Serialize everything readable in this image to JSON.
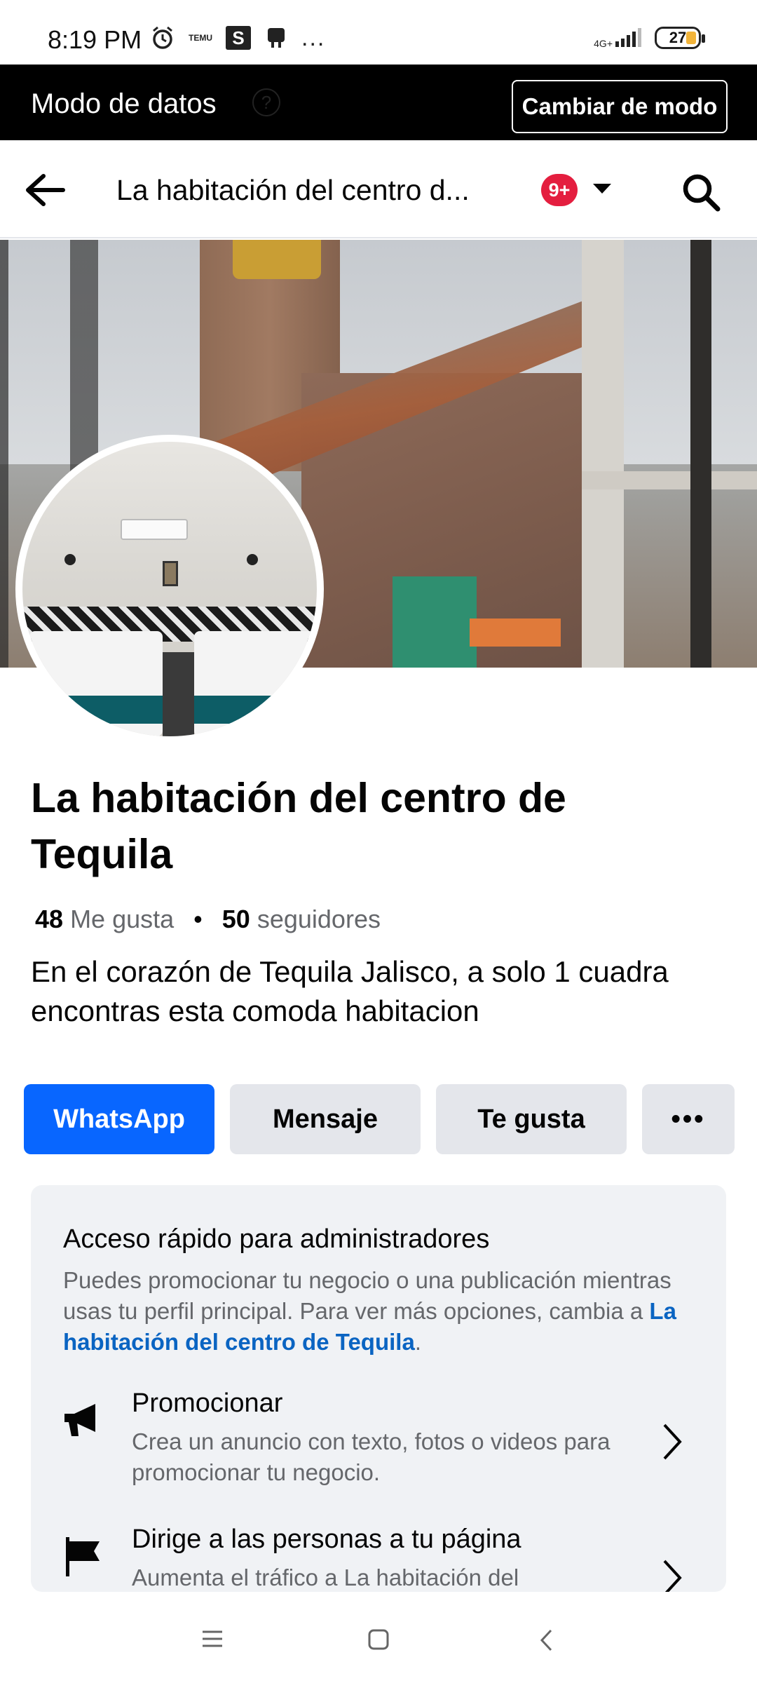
{
  "status_bar": {
    "time": "8:19 PM",
    "network": "4G+",
    "battery": "27",
    "temu_label": "TEMU",
    "s_label": "S",
    "more": "..."
  },
  "data_mode": {
    "label": "Modo de datos",
    "button": "Cambiar de modo"
  },
  "navbar": {
    "title": "La habitación del centro d...",
    "badge": "9+"
  },
  "page": {
    "name": "La habitación del centro de Tequila",
    "likes_count": "48",
    "likes_label": "Me gusta",
    "followers_count": "50",
    "followers_label": "seguidores",
    "description": "En el corazón de Tequila Jalisco, a solo 1 cuadra encontras esta comoda habitacion"
  },
  "actions": {
    "whatsapp": "WhatsApp",
    "message": "Mensaje",
    "like": "Te gusta",
    "more": "•••"
  },
  "admin_card": {
    "title": "Acceso rápido para administradores",
    "text_before": "Puedes promocionar tu negocio o una publicación mientras usas tu perfil principal. Para ver más opciones, cambia a ",
    "text_link": "La habitación del centro de Tequila",
    "text_after": ".",
    "items": [
      {
        "title": "Promocionar",
        "subtitle": "Crea un anuncio con texto, fotos o videos para promocionar tu negocio."
      },
      {
        "title": "Dirige a las personas a tu página",
        "subtitle": "Aumenta el tráfico a La habitación del"
      }
    ]
  },
  "colors": {
    "primary": "#0866ff",
    "badge": "#e41e3f",
    "link": "#0a64c2",
    "card_bg": "#f0f2f5",
    "button_bg": "#e4e6eb"
  }
}
